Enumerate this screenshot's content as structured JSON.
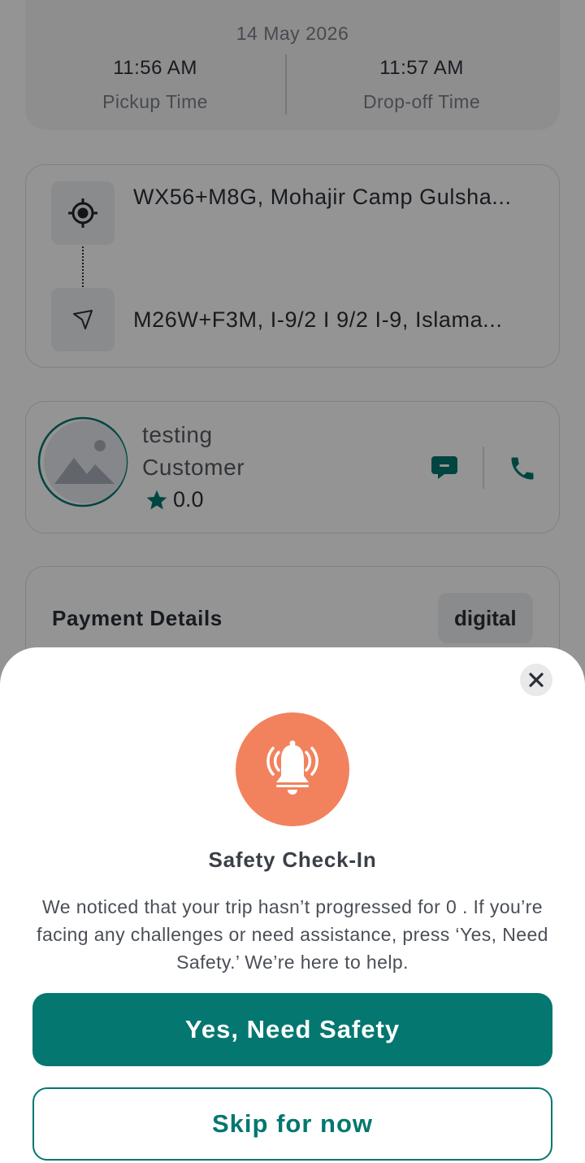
{
  "trip_times": {
    "date": "14 May 2026",
    "pickup_time": "11:56 AM",
    "pickup_label": "Pickup Time",
    "dropoff_time": "11:57 AM",
    "dropoff_label": "Drop-off Time"
  },
  "route": {
    "pickup_icon": "target-location-icon",
    "pickup_address": "WX56+M8G, Mohajir Camp Gulsha...",
    "dropoff_icon": "navigation-arrow-icon",
    "dropoff_address": "M26W+F3M, I-9/2 I 9/2 I-9, Islama..."
  },
  "customer": {
    "avatar_icon": "image-placeholder-icon",
    "name": "testing",
    "role": "Customer",
    "rating": "0.0",
    "rating_icon": "star-icon",
    "chat_icon": "chat-icon",
    "call_icon": "phone-icon"
  },
  "payment": {
    "title": "Payment Details",
    "method": "digital"
  },
  "safety_sheet": {
    "close_icon": "close-icon",
    "alarm_icon": "alarm-bell-icon",
    "title": "Safety Check-In",
    "message": "We noticed that your trip hasn’t progressed for 0  . If you’re facing any challenges or need assistance, press ‘Yes, Need Safety.’ We’re here to help.",
    "primary_button": "Yes, Need Safety",
    "secondary_button": "Skip for now"
  },
  "colors": {
    "accent": "#037770",
    "alarm": "#f2825d",
    "scrim": "rgba(0,0,0,0.42)"
  }
}
